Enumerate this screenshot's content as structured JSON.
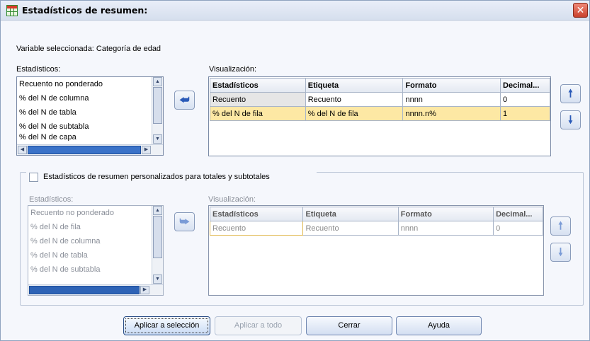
{
  "window": {
    "title": "Estadísticos de resumen:"
  },
  "selected_variable": "Variable seleccionada: Categoría de edad",
  "top": {
    "stats_label": "Estadísticos:",
    "stats_items": [
      "Recuento no ponderado",
      "% del N de columna",
      "% del N de tabla",
      "% del N de subtabla",
      "% del N de capa"
    ],
    "display_label": "Visualización:",
    "columns": [
      "Estadísticos",
      "Etiqueta",
      "Formato",
      "Decimal..."
    ],
    "rows": [
      [
        "Recuento",
        "Recuento",
        "nnnn",
        "0"
      ],
      [
        "% del N de fila",
        "% del N de fila",
        "nnnn.n%",
        "1"
      ]
    ],
    "selected_row": 1
  },
  "custom": {
    "checkbox_label": "Estadísticos de resumen personalizados para totales y subtotales",
    "checked": false,
    "stats_label": "Estadísticos:",
    "stats_items": [
      "Recuento no ponderado",
      "% del N de fila",
      "% del N de columna",
      "% del N de tabla",
      "% del N de subtabla"
    ],
    "display_label": "Visualización:",
    "columns": [
      "Estadísticos",
      "Etiqueta",
      "Formato",
      "Decimal..."
    ],
    "rows": [
      [
        "Recuento",
        "Recuento",
        "nnnn",
        "0"
      ]
    ]
  },
  "buttons": {
    "apply_selection": "Aplicar a selección",
    "apply_all": "Aplicar a todo",
    "close": "Cerrar",
    "help": "Ayuda"
  },
  "icons": {
    "move_left": "arrow-left-icon",
    "move_right": "arrow-right-icon",
    "up": "arrow-up-icon",
    "down": "arrow-down-icon"
  }
}
